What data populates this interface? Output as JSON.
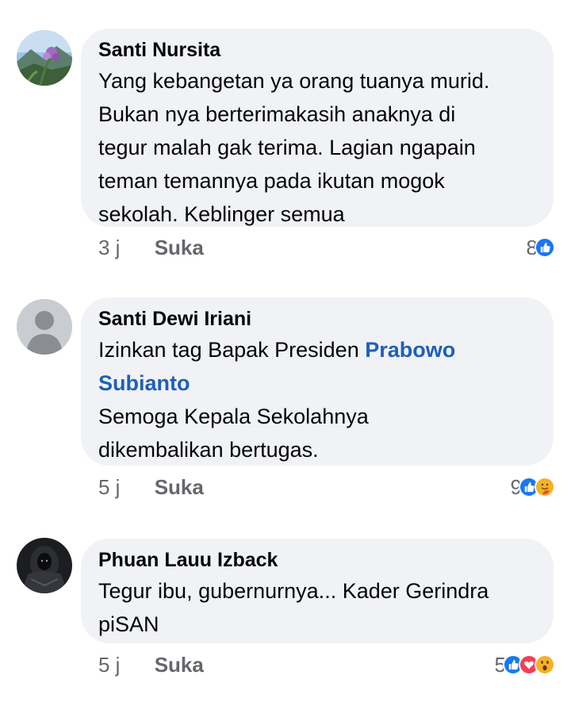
{
  "comments": [
    {
      "author": "Santi Nursita",
      "lines": [
        "Yang kebangetan ya orang tuanya murid.",
        "Bukan nya berterimakasih anaknya di",
        "tegur malah gak terima. Lagian ngapain",
        "teman temannya pada ikutan mogok",
        "sekolah. Keblinger semua"
      ],
      "time": "3 j",
      "like_label": "Suka",
      "reaction_count": "8",
      "reactions": [
        "like-icon"
      ],
      "avatar": "landscape-avatar"
    },
    {
      "author": "Santi Dewi Iriani",
      "line1_prefix": "Izinkan tag Bapak Presiden ",
      "mention_part1": "Prabowo",
      "mention_part2": "Subianto",
      "lines_after": [
        "Semoga Kepala Sekolahnya",
        "dikembalikan bertugas."
      ],
      "time": "5 j",
      "like_label": "Suka",
      "reaction_count": "9",
      "reactions": [
        "like-icon",
        "care-icon"
      ],
      "avatar": "default-avatar"
    },
    {
      "author": "Phuan Lauu Izback",
      "lines": [
        "Tegur ibu, gubernurnya... Kader Gerindra",
        "piSAN"
      ],
      "time": "5 j",
      "like_label": "Suka",
      "reaction_count": "5",
      "reactions": [
        "like-icon",
        "love-icon",
        "wow-icon"
      ],
      "avatar": "dark-figure-avatar"
    }
  ],
  "colors": {
    "bubble": "#f0f2f5",
    "meta_text": "#65676b",
    "mention": "#1f5fb8",
    "like_blue": "#1877f2",
    "love_red": "#f33e58",
    "emoji_yellow": "#f7b125"
  }
}
